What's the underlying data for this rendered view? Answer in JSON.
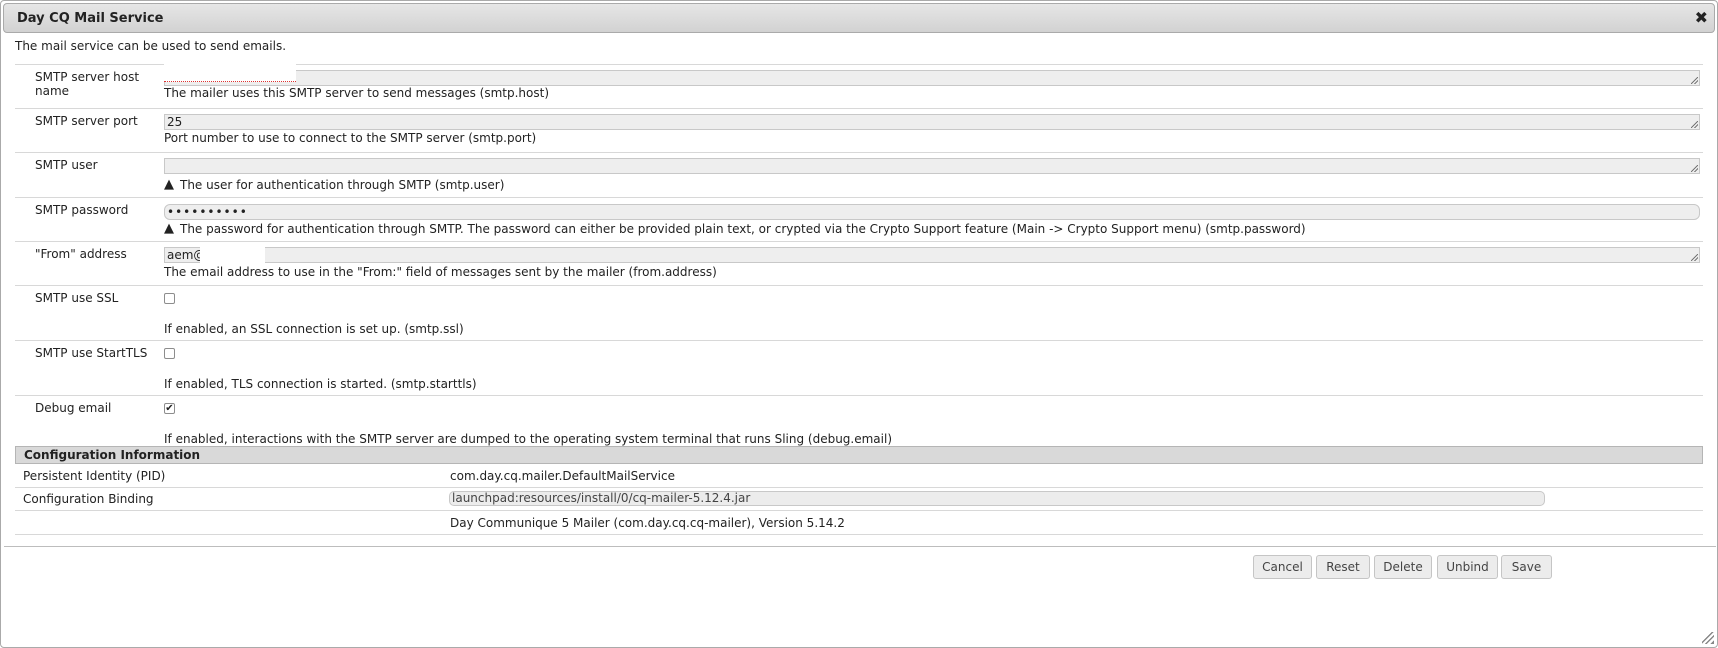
{
  "dialog": {
    "title": "Day CQ Mail Service",
    "intro": "The mail service can be used to send emails."
  },
  "fields": {
    "host": {
      "label": "SMTP server host name",
      "value": "",
      "description": "The mailer uses this SMTP server to send messages (smtp.host)"
    },
    "port": {
      "label": "SMTP server port",
      "value": "25",
      "description": "Port number to use to connect to the SMTP server (smtp.port)"
    },
    "user": {
      "label": "SMTP user",
      "value": "",
      "description": "The user for authentication through SMTP (smtp.user)"
    },
    "password": {
      "label": "SMTP password",
      "value": "••••••••••",
      "description": "The password for authentication through SMTP. The password can either be provided plain text, or crypted via the Crypto Support feature (Main -> Crypto Support menu) (smtp.password)"
    },
    "from": {
      "label": "\"From\" address",
      "value": "aem@",
      "description": "The email address to use in the \"From:\" field of messages sent by the mailer (from.address)"
    },
    "ssl": {
      "label": "SMTP use SSL",
      "checked": false,
      "description": "If enabled, an SSL connection is set up. (smtp.ssl)"
    },
    "starttls": {
      "label": "SMTP use StartTLS",
      "checked": false,
      "description": "If enabled, TLS connection is started. (smtp.starttls)"
    },
    "debug": {
      "label": "Debug email",
      "checked": true,
      "check_mark": "✔",
      "description": "If enabled, interactions with the SMTP server are dumped to the operating system terminal that runs Sling (debug.email)"
    }
  },
  "config_info": {
    "header": "Configuration Information",
    "pid_label": "Persistent Identity (PID)",
    "pid_value": "com.day.cq.mailer.DefaultMailService",
    "binding_label": "Configuration Binding",
    "binding_value": "launchpad:resources/install/0/cq-mailer-5.12.4.jar",
    "bundle_value": "Day Communique 5 Mailer (com.day.cq.cq-mailer), Version 5.14.2"
  },
  "buttons": {
    "cancel": "Cancel",
    "reset": "Reset",
    "delete": "Delete",
    "unbind": "Unbind",
    "save": "Save"
  },
  "icons": {
    "close": "close-icon",
    "warning": "warning-icon"
  },
  "colors": {
    "title_bar": "#d9d9d9",
    "field_bg": "#eeeeee",
    "button_bg": "#ececec"
  }
}
